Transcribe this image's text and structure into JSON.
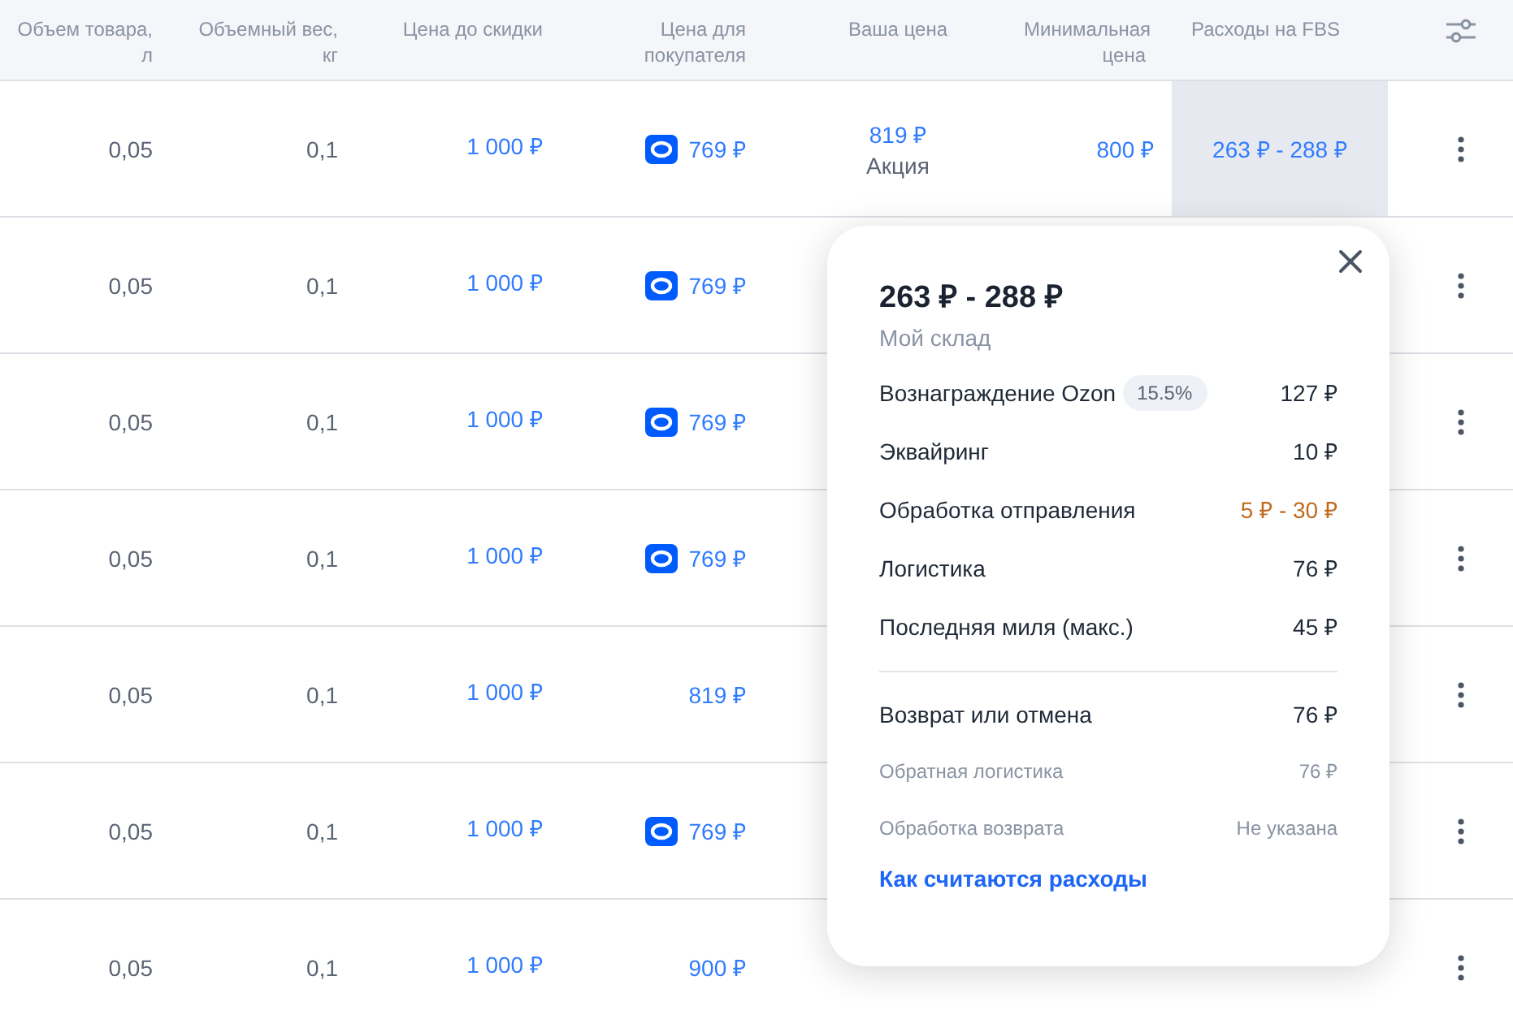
{
  "table": {
    "columns": [
      "Объем товара,\nл",
      "Объемный вес,\nкг",
      "Цена до скидки",
      "Цена для\nпокупателя",
      "Ваша цена",
      "Минимальная\nцена",
      "Расходы на FBS"
    ],
    "rows": [
      {
        "volume": "0,05",
        "weight": "0,1",
        "price_before": "1 000 ₽",
        "buyer_price": "769 ₽",
        "ozon_card": true,
        "your_price": "819 ₽",
        "your_price_note": "Акция",
        "min_price": "800 ₽",
        "fbs": "263 ₽ - 288 ₽",
        "selected": true
      },
      {
        "volume": "0,05",
        "weight": "0,1",
        "price_before": "1 000 ₽",
        "buyer_price": "769 ₽",
        "ozon_card": true
      },
      {
        "volume": "0,05",
        "weight": "0,1",
        "price_before": "1 000 ₽",
        "buyer_price": "769 ₽",
        "ozon_card": true
      },
      {
        "volume": "0,05",
        "weight": "0,1",
        "price_before": "1 000 ₽",
        "buyer_price": "769 ₽",
        "ozon_card": true
      },
      {
        "volume": "0,05",
        "weight": "0,1",
        "price_before": "1 000 ₽",
        "buyer_price": "819 ₽",
        "ozon_card": false
      },
      {
        "volume": "0,05",
        "weight": "0,1",
        "price_before": "1 000 ₽",
        "buyer_price": "769 ₽",
        "ozon_card": true
      },
      {
        "volume": "0,05",
        "weight": "0,1",
        "price_before": "1 000 ₽",
        "buyer_price": "900 ₽",
        "ozon_card": false,
        "selected": false
      }
    ]
  },
  "popover": {
    "title": "263 ₽ - 288 ₽",
    "subtitle": "Мой склад",
    "groups": [
      [
        {
          "kind": "main",
          "label": "Вознаграждение Ozon",
          "badge": "15.5%",
          "value": "127 ₽",
          "warning": false
        },
        {
          "kind": "main",
          "label": "Эквайринг",
          "value": "10 ₽",
          "warning": false
        },
        {
          "kind": "main",
          "label": "Обработка отправления",
          "value": "5 ₽ - 30 ₽",
          "warning": true
        },
        {
          "kind": "main",
          "label": "Логистика",
          "value": "76 ₽",
          "warning": false
        },
        {
          "kind": "main",
          "label": "Последняя миля (макс.)",
          "value": "45 ₽",
          "warning": false
        }
      ],
      [
        {
          "kind": "main",
          "label": "Возврат или отмена",
          "value": "76 ₽",
          "warning": false
        },
        {
          "kind": "sub",
          "label": "Обратная логистика",
          "value": "76 ₽",
          "warning": false
        },
        {
          "kind": "sub",
          "label": "Обработка возврата",
          "value": "Не указана",
          "warning": false
        }
      ]
    ],
    "link": "Как считаются расходы"
  }
}
